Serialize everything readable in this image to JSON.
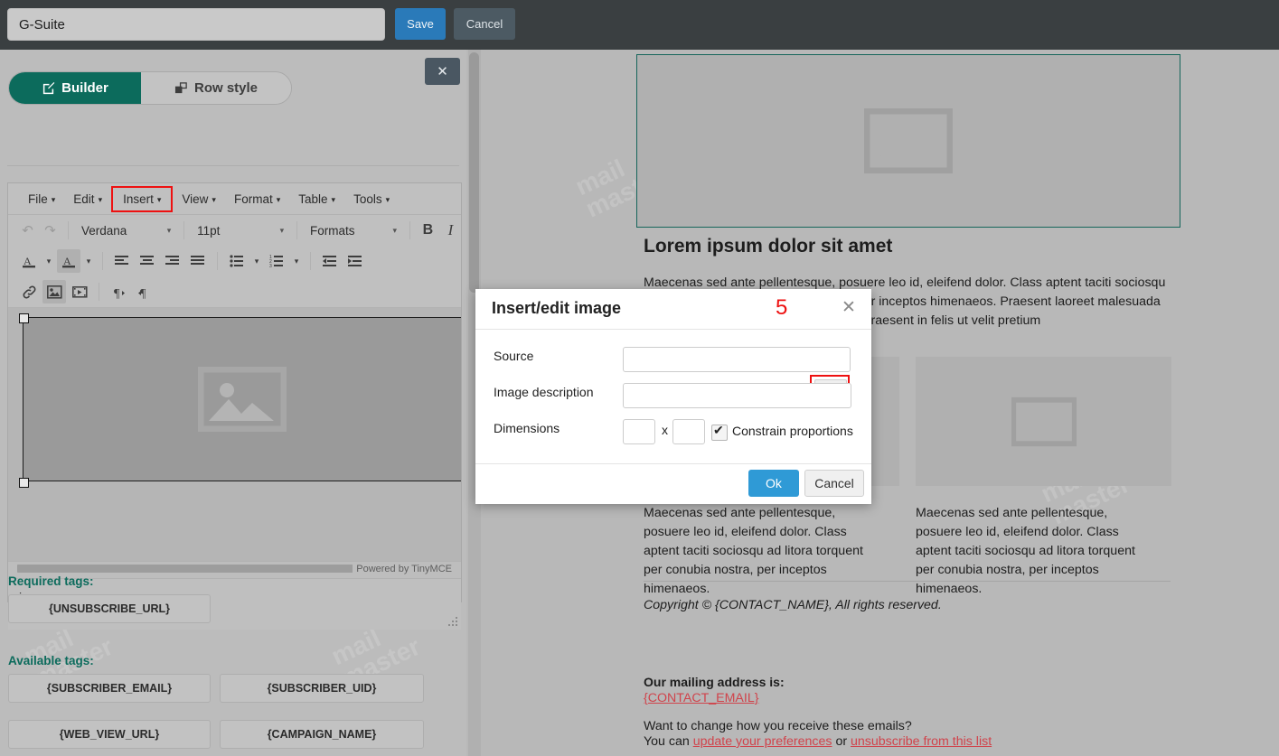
{
  "topbar": {
    "title_value": "G-Suite",
    "title_placeholder": "",
    "save_label": "Save",
    "cancel_label": "Cancel"
  },
  "left_panel": {
    "close_label": "✕",
    "tabs": [
      {
        "label": "Builder",
        "icon": "edit-square-icon",
        "active": true
      },
      {
        "label": "Row style",
        "icon": "layers-icon",
        "active": false
      }
    ],
    "editor": {
      "menubar": [
        {
          "label": "File",
          "caret": "▾"
        },
        {
          "label": "Edit",
          "caret": "▾"
        },
        {
          "label": "Insert",
          "caret": "▾",
          "highlighted": true
        },
        {
          "label": "View",
          "caret": "▾"
        },
        {
          "label": "Format",
          "caret": "▾"
        },
        {
          "label": "Table",
          "caret": "▾"
        },
        {
          "label": "Tools",
          "caret": "▾"
        }
      ],
      "toolbar": {
        "undo": "↶",
        "redo": "↷",
        "font_family": "Verdana",
        "font_size": "11pt",
        "formats": "Formats",
        "bold": "B",
        "italic": "I",
        "caret": "▾"
      },
      "status_path": "img",
      "powered_by": "Powered by TinyMCE"
    },
    "required_tags_label": "Required tags:",
    "required_tags": [
      "{UNSUBSCRIBE_URL}"
    ],
    "available_tags_label": "Available tags:",
    "available_tags": [
      "{SUBSCRIBER_EMAIL}",
      "{SUBSCRIBER_UID}",
      "{WEB_VIEW_URL}",
      "{CAMPAIGN_NAME}"
    ]
  },
  "preview": {
    "heading": "Lorem ipsum dolor sit amet",
    "paragraph": "Maecenas sed ante pellentesque, posuere leo id, eleifend dolor. Class aptent taciti sociosqu ad litora torquent per conubia nostra, per inceptos himenaeos. Praesent laoreet malesuada mauris, a sollicitudin eros eu posuere. Praesent in felis ut velit pretium",
    "column_text": "Maecenas sed ante pellentesque, posuere leo id, eleifend dolor. Class aptent taciti sociosqu ad litora torquent per conubia nostra, per inceptos himenaeos.",
    "copyright": "Copyright © {CONTACT_NAME}, All rights reserved.",
    "mailing_label": "Our mailing address is:",
    "mailing_address": "{CONTACT_EMAIL}",
    "want_change": "Want to change how you receive these emails?",
    "you_can_prefix": "You can ",
    "update_link": "update your preferences",
    "or_text": " or ",
    "unsubscribe_link": "unsubscribe from this list"
  },
  "modal": {
    "title": "Insert/edit image",
    "step_badge": "5",
    "close_label": "✕",
    "source_label": "Source",
    "source_value": "",
    "browse_icon": "folder-search-icon",
    "description_label": "Image description",
    "description_value": "",
    "dimensions_label": "Dimensions",
    "width_value": "",
    "height_value": "",
    "dim_sep": "x",
    "constrain_label": "Constrain proportions",
    "constrain_checked": true,
    "ok_label": "Ok",
    "cancel_label": "Cancel"
  },
  "watermark": {
    "line1": "mail",
    "line2": "master"
  },
  "colors": {
    "accent_teal": "#0c6b5c",
    "save_blue": "#2a7ab9",
    "ok_blue": "#2f9ad6",
    "highlight_red": "#ee1111",
    "link_red": "#d0434b",
    "topbar_dark": "#3a3f41"
  }
}
